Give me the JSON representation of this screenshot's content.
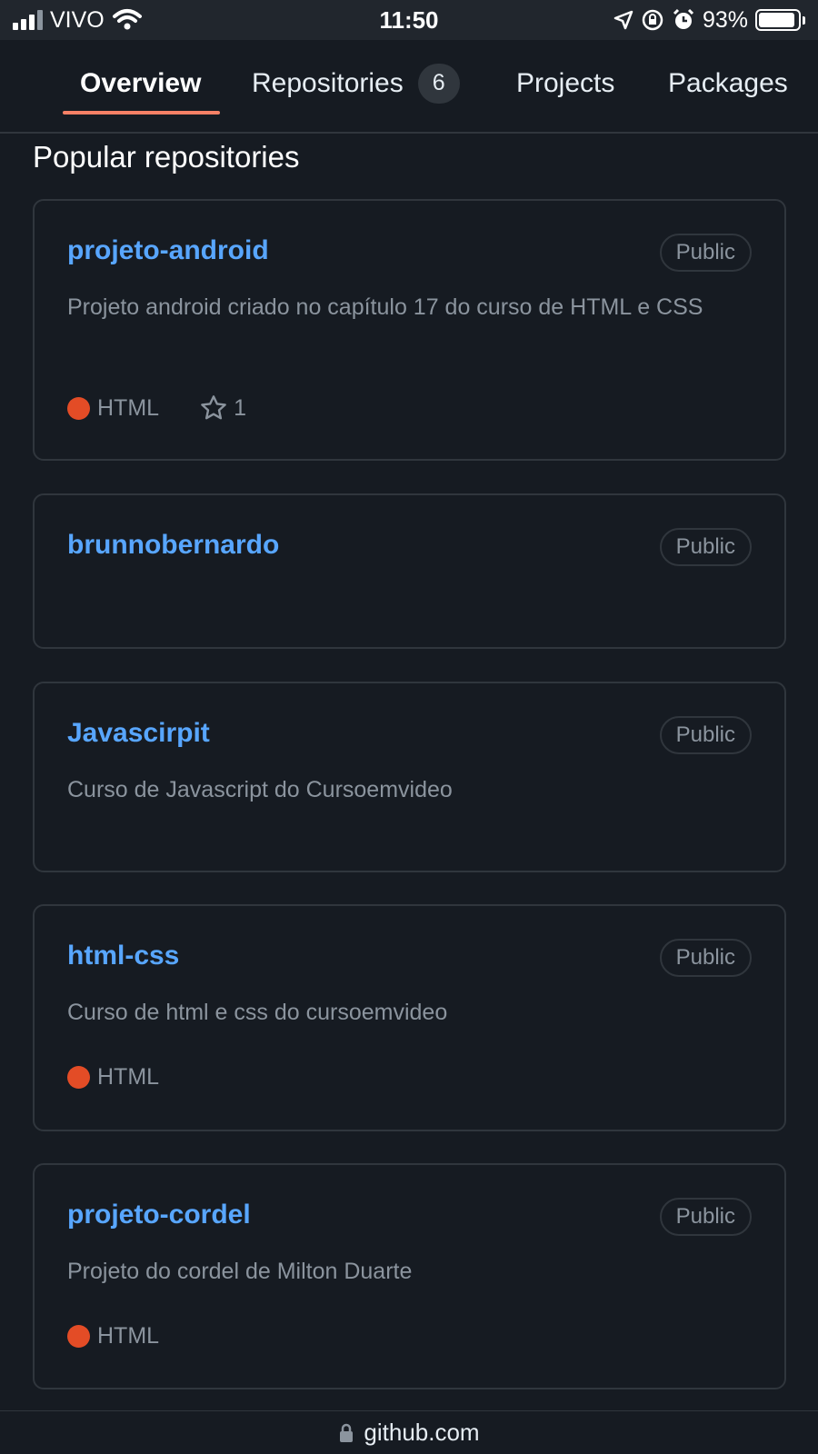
{
  "status_bar": {
    "carrier": "VIVO",
    "time": "11:50",
    "battery_percent": "93%",
    "battery_level": 0.93,
    "icons": [
      "signal-icon",
      "wifi-icon",
      "location-icon",
      "rotation-lock-icon",
      "alarm-icon",
      "battery-icon"
    ]
  },
  "tabs": [
    {
      "label": "Overview",
      "active": true
    },
    {
      "label": "Repositories",
      "count": "6",
      "active": false
    },
    {
      "label": "Projects",
      "active": false
    },
    {
      "label": "Packages",
      "active": false
    }
  ],
  "section_title": "Popular repositories",
  "repos": [
    {
      "name": "projeto-android",
      "visibility": "Public",
      "description": "Projeto android criado no capítulo 17 do curso de HTML e CSS",
      "language": "HTML",
      "language_color": "#e34c26",
      "stars": "1"
    },
    {
      "name": "brunnobernardo",
      "visibility": "Public"
    },
    {
      "name": "Javascirpit",
      "visibility": "Public",
      "description": "Curso de Javascript do Cursoemvideo"
    },
    {
      "name": "html-css",
      "visibility": "Public",
      "description": "Curso de html e css do cursoemvideo",
      "language": "HTML",
      "language_color": "#e34c26"
    },
    {
      "name": "projeto-cordel",
      "visibility": "Public",
      "description": "Projeto do cordel de Milton Duarte",
      "language": "HTML",
      "language_color": "#e34c26"
    }
  ],
  "url_bar": {
    "domain": "github.com",
    "icon": "lock-icon"
  },
  "colors": {
    "background": "#161b22",
    "link": "#58a6ff",
    "muted": "#8b949e",
    "border": "#30363d",
    "tab_underline": "#f78166"
  }
}
